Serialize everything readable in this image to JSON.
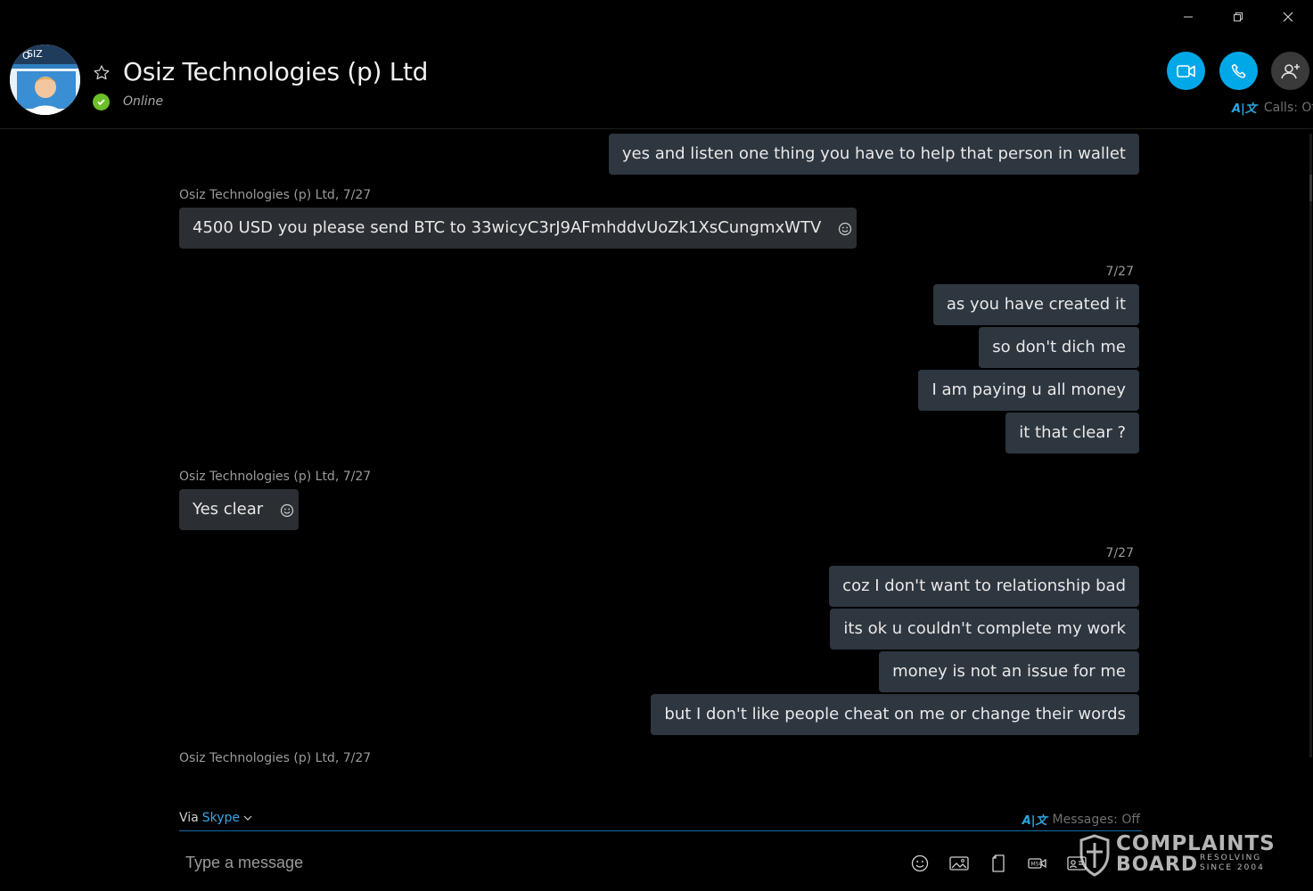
{
  "window": {
    "minimize_icon": "minimize-icon",
    "restore_icon": "restore-icon",
    "close_icon": "close-icon"
  },
  "header": {
    "contact_name": "Osiz Technologies (p) Ltd",
    "status": "Online",
    "status_color": "#6cbf2a",
    "avatar_text": "SIZ",
    "calls_translation": "Calls: Off",
    "accent": "#00a8e8"
  },
  "messages": [
    {
      "dir": "out",
      "text": "yes and listen one thing you have to help that person in wallet"
    },
    {
      "dir": "meta-in",
      "text": "Osiz Technologies (p) Ltd, 7/27"
    },
    {
      "dir": "in",
      "text": "4500 USD you please send BTC to 33wicyC3rJ9AFmhddvUoZk1XsCungmxWTV"
    },
    {
      "dir": "meta-out",
      "text": "7/27"
    },
    {
      "dir": "out",
      "text": "as you have created it"
    },
    {
      "dir": "out",
      "text": "so don't dich me"
    },
    {
      "dir": "out",
      "text": "I am paying u all money"
    },
    {
      "dir": "out",
      "text": "it that clear ?"
    },
    {
      "dir": "meta-in",
      "text": "Osiz Technologies (p) Ltd, 7/27"
    },
    {
      "dir": "in",
      "text": "Yes clear"
    },
    {
      "dir": "meta-out",
      "text": "7/27"
    },
    {
      "dir": "out",
      "text": "coz I don't want to relationship bad"
    },
    {
      "dir": "out",
      "text": "its ok u couldn't complete my work"
    },
    {
      "dir": "out",
      "text": "money is not an issue for me"
    },
    {
      "dir": "out",
      "text": "but I don't like people cheat on me or change their words"
    },
    {
      "dir": "meta-in",
      "text": "Osiz Technologies (p) Ltd, 7/27"
    }
  ],
  "composer": {
    "via_label": "Via",
    "via_service": "Skype",
    "messages_translation": "Messages: Off",
    "placeholder": "Type a message",
    "tools": [
      "emoji-icon",
      "image-icon",
      "file-icon",
      "video-message-icon",
      "contact-card-icon"
    ]
  },
  "watermark": {
    "line1": "COMPLAINTS",
    "line2": "BOARD",
    "tagline1": "RESOLVING",
    "tagline2": "SINCE 2004"
  }
}
